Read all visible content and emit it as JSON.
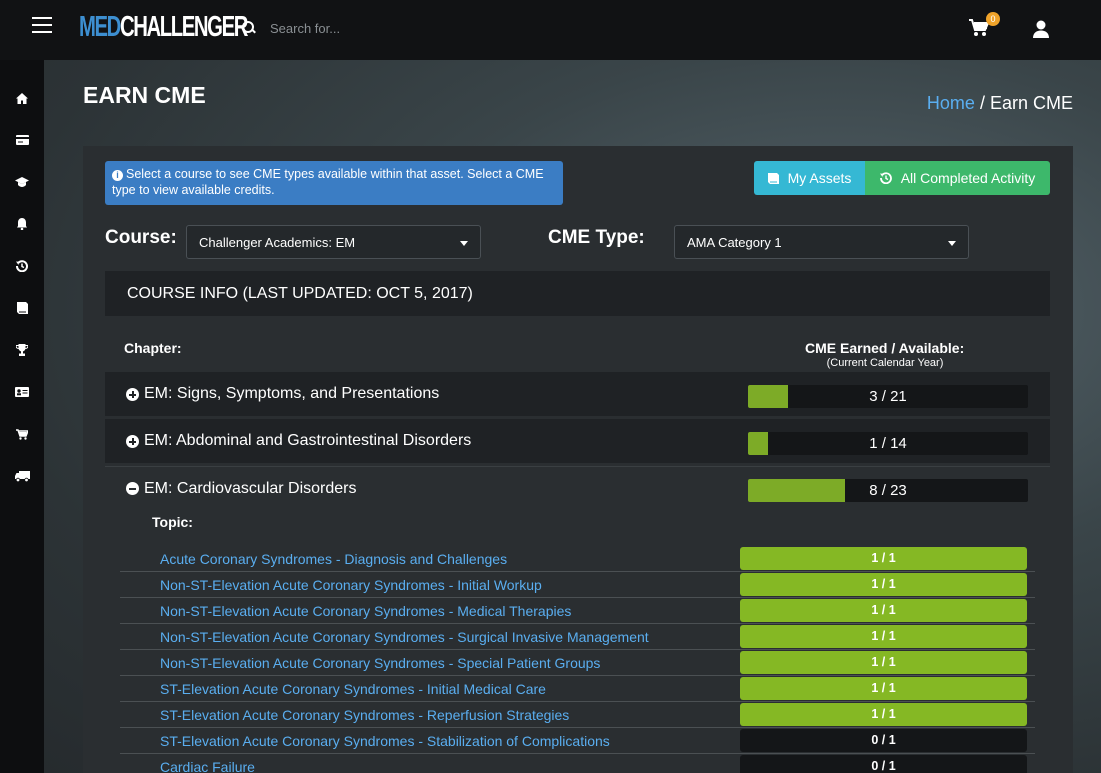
{
  "header": {
    "logo": {
      "med": "MED",
      "challenger": "CHALLENGER"
    },
    "search_placeholder": "Search for...",
    "cart_count": "0"
  },
  "sidebar": {
    "icons": [
      "home-icon",
      "credit-card-icon",
      "graduation-cap-icon",
      "bell-icon",
      "history-icon",
      "book-icon",
      "trophy-icon",
      "id-card-icon",
      "cart-icon",
      "truck-icon"
    ]
  },
  "page": {
    "title": "EARN CME",
    "breadcrumb": {
      "home": "Home",
      "separator": "/",
      "current": "Earn CME"
    }
  },
  "info_message": "Select a course to see CME types available within that asset. Select a CME type to view available credits.",
  "buttons": {
    "my_assets": "My Assets",
    "all_completed": "All Completed Activity"
  },
  "filters": {
    "course_label": "Course:",
    "course_value": "Challenger Academics: EM",
    "cme_type_label": "CME Type:",
    "cme_type_value": "AMA Category 1"
  },
  "course_info": "COURSE INFO (LAST UPDATED: OCT 5, 2017)",
  "columns": {
    "chapter": "Chapter:",
    "cme_earned": "CME Earned / Available:",
    "cme_earned_sub": "(Current Calendar Year)"
  },
  "chapters": [
    {
      "title": "EM: Signs, Symptoms, and Presentations",
      "earned": 3,
      "available": 21,
      "label": "3 / 21",
      "expanded": false
    },
    {
      "title": "EM: Abdominal and Gastrointestinal Disorders",
      "earned": 1,
      "available": 14,
      "label": "1 / 14",
      "expanded": false
    },
    {
      "title": "EM: Cardiovascular Disorders",
      "earned": 8,
      "available": 23,
      "label": "8 / 23",
      "expanded": true
    }
  ],
  "topic_label": "Topic:",
  "topics": [
    {
      "title": "Acute Coronary Syndromes - Diagnosis and Challenges",
      "label": "1 / 1",
      "complete": true
    },
    {
      "title": "Non-ST-Elevation Acute Coronary Syndromes - Initial Workup",
      "label": "1 / 1",
      "complete": true
    },
    {
      "title": "Non-ST-Elevation Acute Coronary Syndromes - Medical Therapies",
      "label": "1 / 1",
      "complete": true
    },
    {
      "title": "Non-ST-Elevation Acute Coronary Syndromes - Surgical Invasive Management",
      "label": "1 / 1",
      "complete": true
    },
    {
      "title": "Non-ST-Elevation Acute Coronary Syndromes - Special Patient Groups",
      "label": "1 / 1",
      "complete": true
    },
    {
      "title": "ST-Elevation Acute Coronary Syndromes - Initial Medical Care",
      "label": "1 / 1",
      "complete": true
    },
    {
      "title": "ST-Elevation Acute Coronary Syndromes - Reperfusion Strategies",
      "label": "1 / 1",
      "complete": true
    },
    {
      "title": "ST-Elevation Acute Coronary Syndromes - Stabilization of Complications",
      "label": "0 / 1",
      "complete": false
    },
    {
      "title": "Cardiac Failure",
      "label": "0 / 1",
      "complete": false
    }
  ],
  "colors": {
    "accent": "#5aaef0",
    "progress": "#7dab27",
    "info": "#3b7dc4",
    "assets_btn": "#35b8d4",
    "completed_btn": "#3db86b",
    "badge": "#f0a32a"
  }
}
